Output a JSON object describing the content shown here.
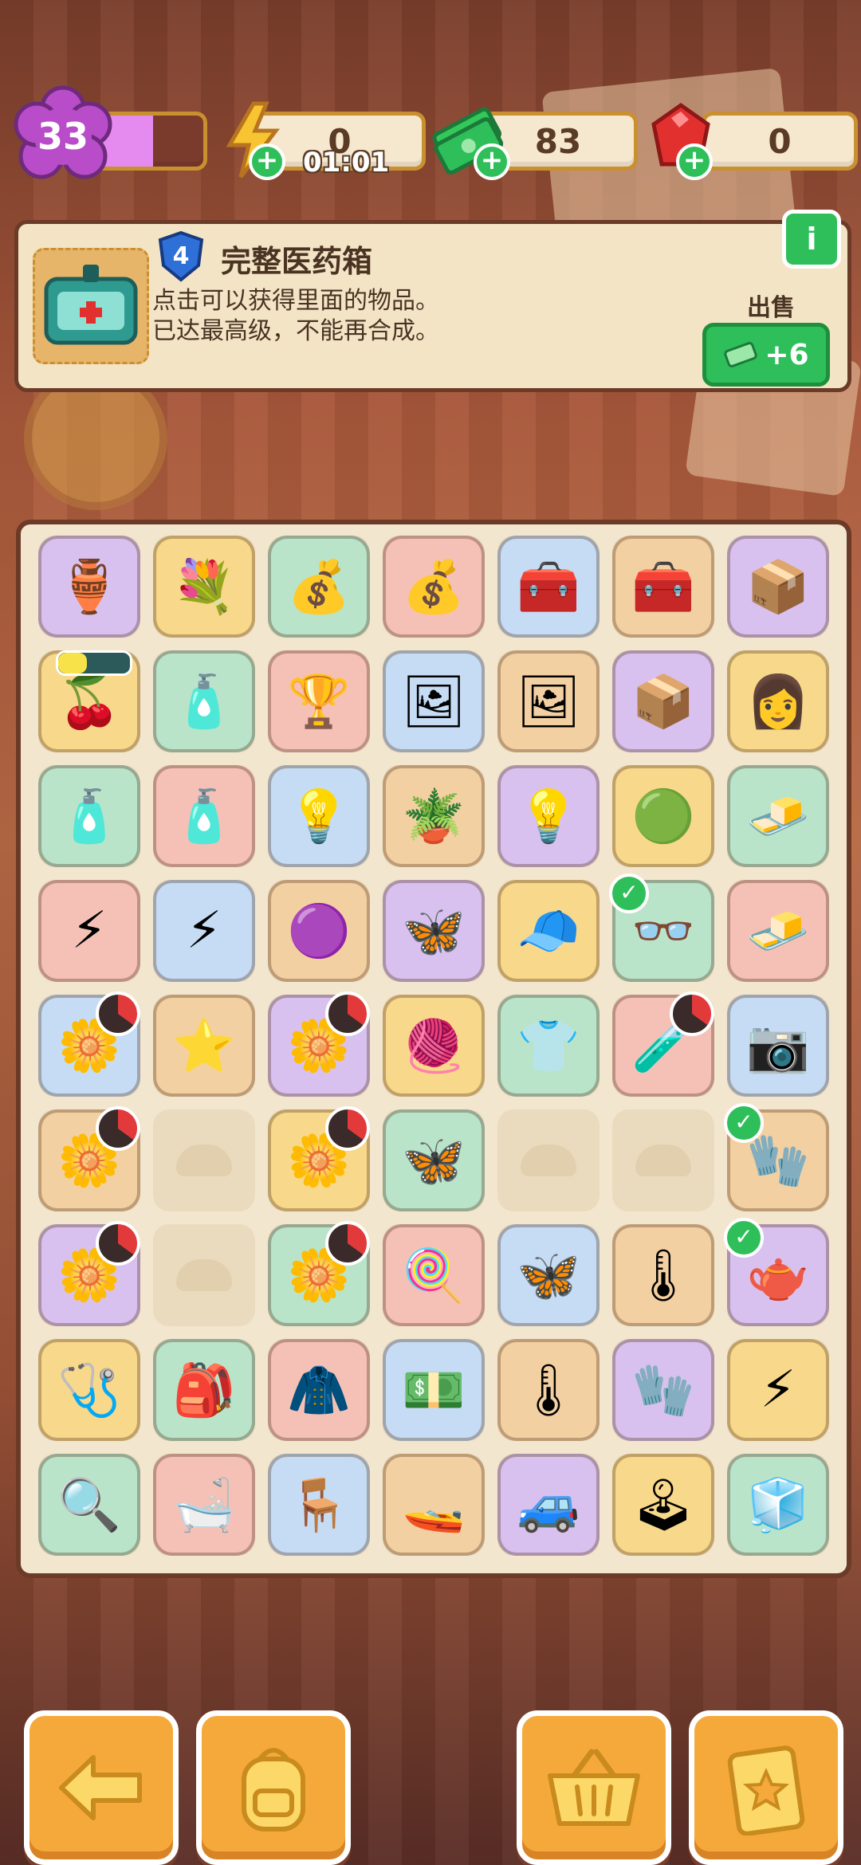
{
  "hud": {
    "level": "33",
    "level_progress": 0.55,
    "energy_value": "0",
    "energy_timer": "01:01",
    "cash_value": "83",
    "gems_value": "0"
  },
  "info": {
    "item_level": "4",
    "title": "完整医药箱",
    "desc_line1": "点击可以获得里面的物品。",
    "desc_line2": "已达最高级，不能再合成。",
    "sell_label": "出售",
    "sell_price": "+6"
  },
  "board": {
    "cells": [
      {
        "name": "vase",
        "icon": "🏺"
      },
      {
        "name": "flower-bush",
        "icon": "💐"
      },
      {
        "name": "coin-sack",
        "icon": "💰"
      },
      {
        "name": "coin-sack",
        "icon": "💰"
      },
      {
        "name": "red-toolbox",
        "icon": "🧰"
      },
      {
        "name": "red-toolbox",
        "icon": "🧰"
      },
      {
        "name": "wood-crate",
        "icon": "📦"
      },
      {
        "name": "cherry-branch",
        "icon": "🍒",
        "energy": true
      },
      {
        "name": "water-bottle",
        "icon": "🧴"
      },
      {
        "name": "star-trophy-cabinet",
        "icon": "🏆"
      },
      {
        "name": "portrait-frame",
        "icon": "🖼"
      },
      {
        "name": "couple-frame",
        "icon": "🖼"
      },
      {
        "name": "cardboard-box",
        "icon": "📦"
      },
      {
        "name": "maid-character",
        "icon": "👩"
      },
      {
        "name": "soap-bottle",
        "icon": "🧴"
      },
      {
        "name": "soap-bottle",
        "icon": "🧴"
      },
      {
        "name": "box-lightbulb",
        "icon": "💡"
      },
      {
        "name": "box-plant",
        "icon": "🪴"
      },
      {
        "name": "box-lightbulb",
        "icon": "💡"
      },
      {
        "name": "green-sponge",
        "icon": "🟢"
      },
      {
        "name": "sugar-cubes",
        "icon": "🧈"
      },
      {
        "name": "moth-energy",
        "icon": "⚡"
      },
      {
        "name": "moth-energy",
        "icon": "⚡"
      },
      {
        "name": "purple-blob",
        "icon": "🟣"
      },
      {
        "name": "purple-moth",
        "icon": "🦋"
      },
      {
        "name": "green-cap",
        "icon": "🧢"
      },
      {
        "name": "round-glasses",
        "icon": "👓",
        "check": true
      },
      {
        "name": "sugar-cubes",
        "icon": "🧈"
      },
      {
        "name": "cotton-plant",
        "icon": "🌼",
        "timer": true
      },
      {
        "name": "purple-star",
        "icon": "⭐"
      },
      {
        "name": "cotton-plant",
        "icon": "🌼",
        "timer": true
      },
      {
        "name": "yarn-ball",
        "icon": "🧶"
      },
      {
        "name": "purple-sweater",
        "icon": "👕"
      },
      {
        "name": "medicine-kit",
        "icon": "🧪",
        "timer": true
      },
      {
        "name": "photo-bag",
        "icon": "📷"
      },
      {
        "name": "cotton-plant",
        "icon": "🌼",
        "timer": true
      },
      {
        "name": "empty",
        "empty": true
      },
      {
        "name": "cotton-plant",
        "icon": "🌼",
        "timer": true
      },
      {
        "name": "white-moth",
        "icon": "🦋"
      },
      {
        "name": "empty",
        "empty": true
      },
      {
        "name": "empty",
        "empty": true
      },
      {
        "name": "red-gloves",
        "icon": "🧤",
        "check": true
      },
      {
        "name": "cotton-plant",
        "icon": "🌼",
        "timer": true
      },
      {
        "name": "empty",
        "empty": true
      },
      {
        "name": "cotton-plant",
        "icon": "🌼",
        "timer": true
      },
      {
        "name": "cotton-candy",
        "icon": "🍭"
      },
      {
        "name": "purple-moth",
        "icon": "🦋"
      },
      {
        "name": "thermometer",
        "icon": "🌡"
      },
      {
        "name": "blue-teapot",
        "icon": "🫖",
        "check": true
      },
      {
        "name": "stethoscope",
        "icon": "🩺"
      },
      {
        "name": "backpack",
        "icon": "🎒"
      },
      {
        "name": "brown-coat",
        "icon": "🧥"
      },
      {
        "name": "cash-pile",
        "icon": "💵"
      },
      {
        "name": "digital-thermometer",
        "icon": "🌡"
      },
      {
        "name": "red-glove",
        "icon": "🧤"
      },
      {
        "name": "energy-medkit",
        "icon": "⚡"
      },
      {
        "name": "crime-scene-dirt",
        "icon": "🔍"
      },
      {
        "name": "crime-scene-bath",
        "icon": "🛁"
      },
      {
        "name": "crime-scene-bench",
        "icon": "🪑"
      },
      {
        "name": "jetski",
        "icon": "🚤"
      },
      {
        "name": "jeep",
        "icon": "🚙"
      },
      {
        "name": "yellow-machine",
        "icon": "🕹"
      },
      {
        "name": "yellow-cube-box",
        "icon": "🧊"
      }
    ]
  },
  "nav": {
    "back_icon": "arrow-left-icon",
    "bag_icon": "backpack-icon",
    "shop_icon": "basket-icon",
    "tasks_icon": "clipboard-star-icon"
  },
  "colors": {
    "accent_green": "#2fbf5a",
    "level_purple": "#e58bf0",
    "button_orange": "#f6a93b",
    "border_brown": "#6b3b27"
  }
}
